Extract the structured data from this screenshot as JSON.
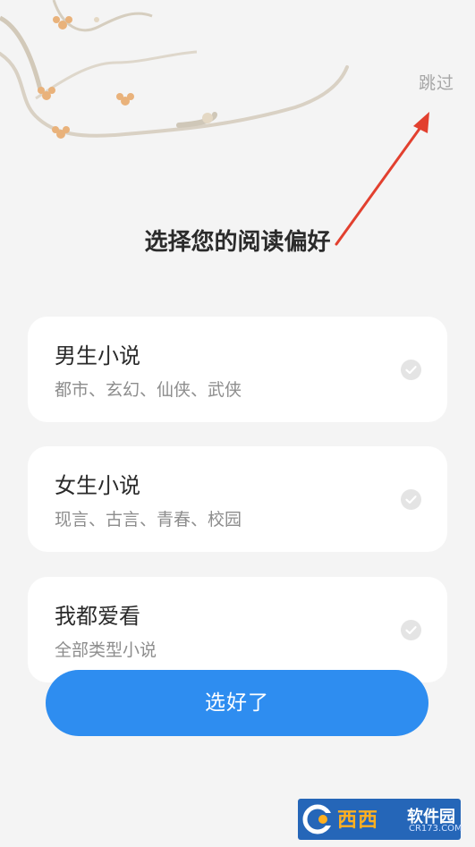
{
  "header": {
    "skip_label": "跳过"
  },
  "page": {
    "title": "选择您的阅读偏好"
  },
  "options": [
    {
      "title": "男生小说",
      "subtitle": "都市、玄幻、仙侠、武侠"
    },
    {
      "title": "女生小说",
      "subtitle": "现言、古言、青春、校园"
    },
    {
      "title": "我都爱看",
      "subtitle": "全部类型小说"
    }
  ],
  "footer": {
    "confirm_label": "选好了"
  },
  "watermark": {
    "name": "西西",
    "site": "软件园",
    "url": "CR173.COM"
  },
  "colors": {
    "background": "#f4f4f4",
    "card": "#ffffff",
    "accent": "#2e8df0",
    "annotation_arrow": "#e2402f",
    "check": "#e4e4e4"
  },
  "icons": {
    "branch": "plum-blossom-branch-decoration",
    "check": "check-circle-icon",
    "arrow": "annotation-arrow"
  }
}
